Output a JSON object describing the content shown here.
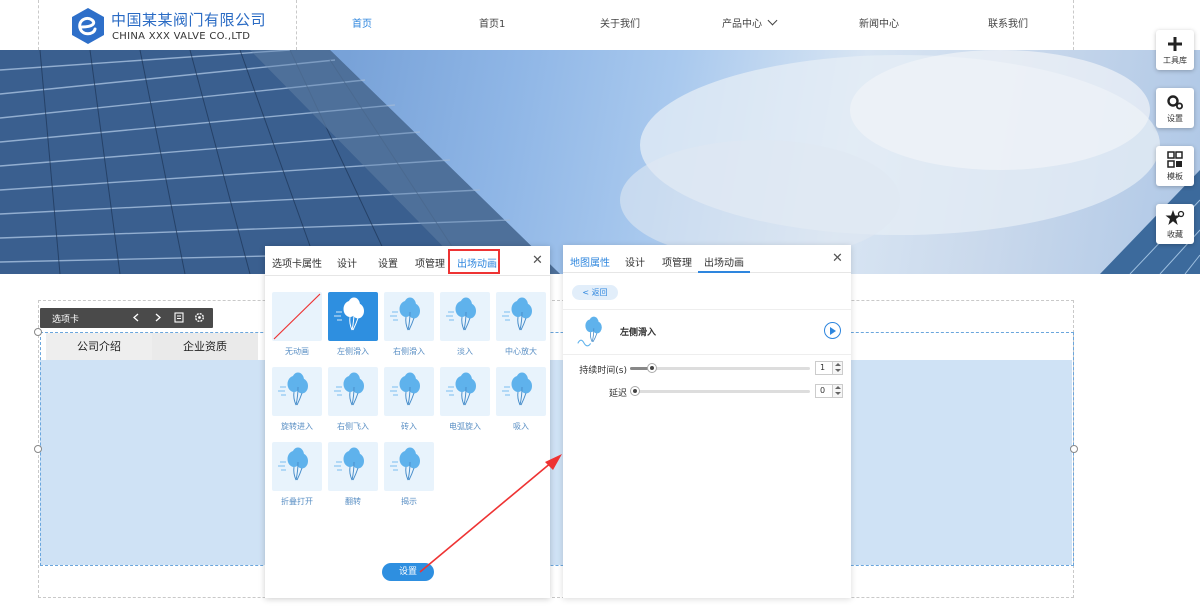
{
  "header": {
    "logo_cn": "中国某某阀门有限公司",
    "logo_en": "CHINA XXX VALVE CO.,LTD",
    "nav": [
      {
        "label": "首页",
        "active": true
      },
      {
        "label": "首页1"
      },
      {
        "label": "关于我们"
      },
      {
        "label": "产品中心"
      },
      {
        "label": "新闻中心"
      },
      {
        "label": "联系我们"
      }
    ]
  },
  "toolbar": {
    "items": [
      {
        "label": "工具库",
        "icon": "plus-icon"
      },
      {
        "label": "设置",
        "icon": "gears-icon"
      },
      {
        "label": "模板",
        "icon": "template-icon"
      },
      {
        "label": "收藏",
        "icon": "star-icon"
      }
    ]
  },
  "tabs_module": {
    "toolbar_label": "选项卡",
    "tabs": [
      "公司介绍",
      "企业资质"
    ]
  },
  "panel1": {
    "tabs": [
      "选项卡属性",
      "设计",
      "设置",
      "项管理",
      "出场动画"
    ],
    "highlighted_tab": "出场动画",
    "animations": [
      {
        "label": "无动画",
        "selected": false
      },
      {
        "label": "左侧滑入",
        "selected": true
      },
      {
        "label": "右侧滑入",
        "selected": false
      },
      {
        "label": "淡入",
        "selected": false
      },
      {
        "label": "中心放大",
        "selected": false
      },
      {
        "label": "旋转进入",
        "selected": false
      },
      {
        "label": "右侧飞入",
        "selected": false
      },
      {
        "label": "砖入",
        "selected": false
      },
      {
        "label": "电弧旋入",
        "selected": false
      },
      {
        "label": "吸入",
        "selected": false
      },
      {
        "label": "折叠打开",
        "selected": false
      },
      {
        "label": "翻转",
        "selected": false
      },
      {
        "label": "揭示",
        "selected": false
      }
    ],
    "button_label": "设置"
  },
  "panel2": {
    "tabs": [
      "地图属性",
      "设计",
      "项管理",
      "出场动画"
    ],
    "active_tab": "出场动画",
    "back_label": "< 返回",
    "current_animation": "左侧滑入",
    "duration_label": "持续时间(s)",
    "duration_value": "1",
    "duration_level": 0.12,
    "delay_label": "延迟",
    "delay_value": "0",
    "delay_level": 0.0
  },
  "colors": {
    "accent": "#2e86de",
    "highlight_box": "#e33333",
    "selection_area": "#cfe2f5"
  }
}
